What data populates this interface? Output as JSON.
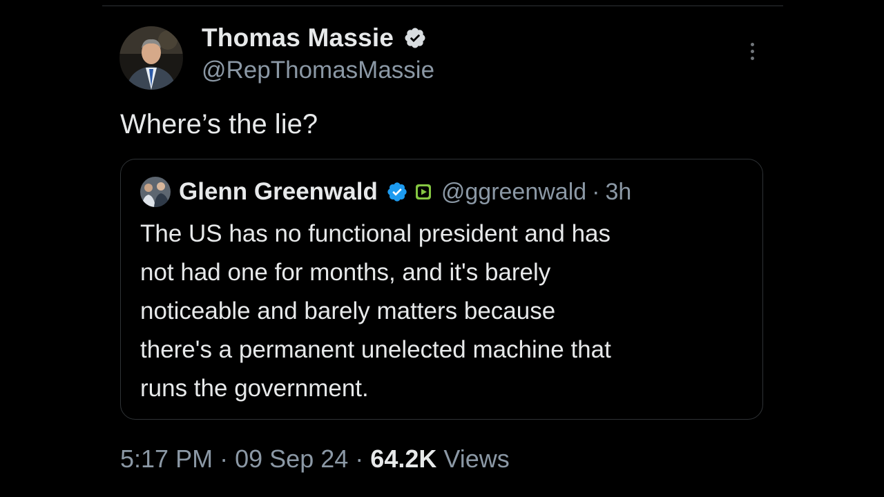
{
  "author": {
    "name": "Thomas Massie",
    "handle": "@RepThomasMassie"
  },
  "tweet": {
    "text": "Where’s the lie?"
  },
  "quote": {
    "name": "Glenn Greenwald",
    "handle": "@ggreenwald",
    "separator": "·",
    "time": "3h",
    "lines": [
      "The US has no functional president and has",
      "not had one for months, and it's barely",
      "noticeable and barely matters because",
      "there's a permanent unelected machine that",
      "runs the government."
    ]
  },
  "meta": {
    "time": "5:17 PM",
    "separator": "·",
    "date": "09 Sep 24",
    "views_count": "64.2K",
    "views_label": "Views"
  },
  "icons": {
    "verified": "verified-badge-icon",
    "rumble": "rumble-badge-icon",
    "more": "more-options-icon"
  },
  "colors": {
    "background": "#000000",
    "text_primary": "#e7e9ea",
    "text_secondary": "#8b98a5",
    "border": "#2f3336",
    "verified_blue": "#1d9bf0",
    "rumble_green": "#85c742"
  }
}
